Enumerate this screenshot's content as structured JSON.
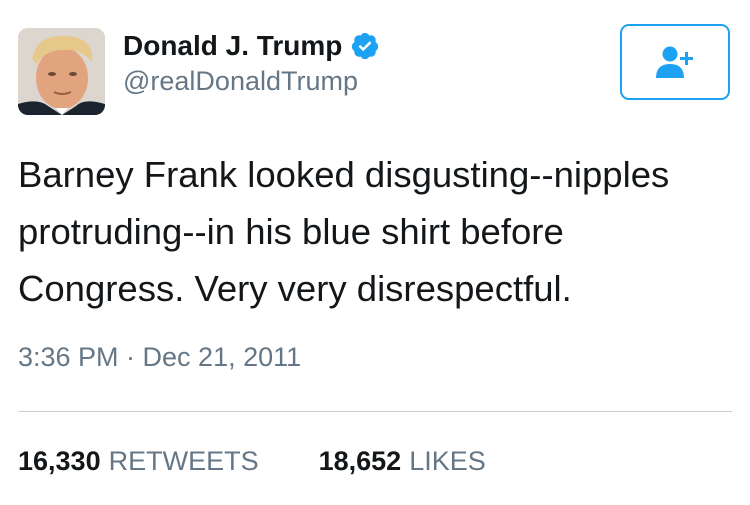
{
  "author": {
    "display_name": "Donald J. Trump",
    "handle": "@realDonaldTrump",
    "verified": true,
    "avatar_icon": "profile-photo",
    "verified_icon": "verified-badge-icon"
  },
  "follow_button": {
    "icon": "add-user-icon"
  },
  "tweet": {
    "text": "Barney Frank looked disgusting--nipples\nprotruding--in his blue shirt before\nCongress. Very very disrespectful.",
    "timestamp": "3:36 PM · Dec 21, 2011"
  },
  "stats": {
    "retweets_count": "16,330",
    "retweets_label": "RETWEETS",
    "likes_count": "18,652",
    "likes_label": "LIKES"
  },
  "colors": {
    "accent": "#1da1f2",
    "text": "#14171a",
    "secondary_text": "#657786",
    "divider": "#c8d0d6"
  }
}
